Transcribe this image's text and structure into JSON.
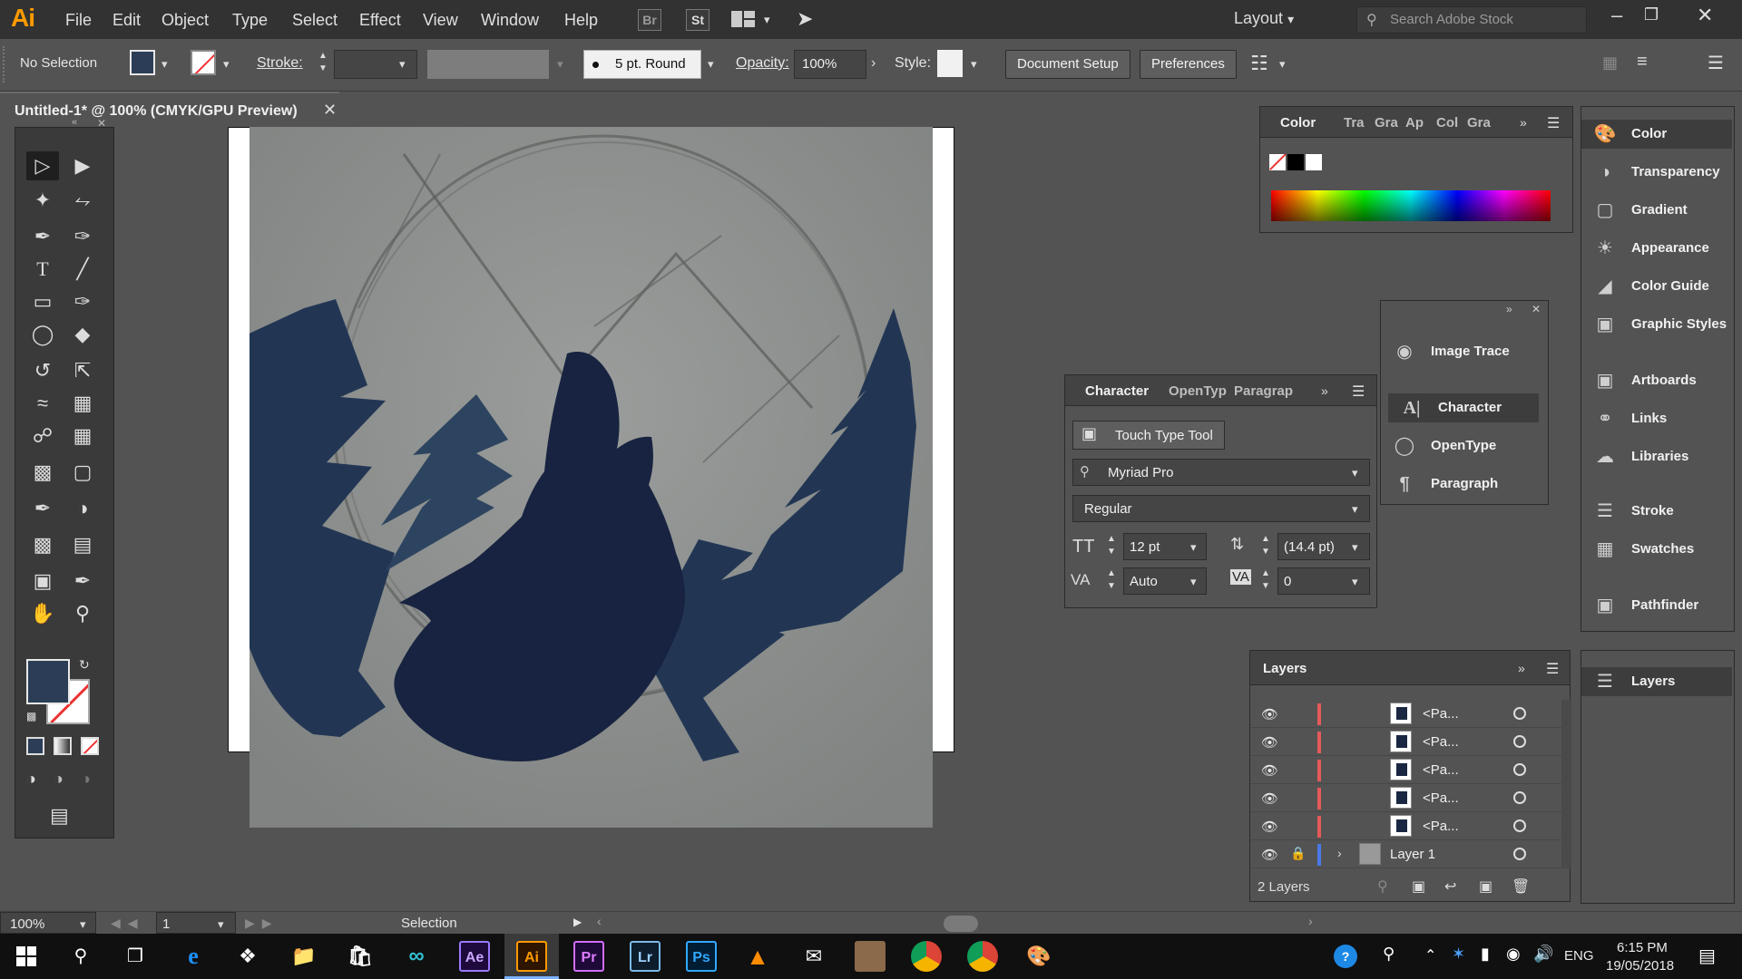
{
  "menubar": {
    "logo": "Ai",
    "menus": [
      "File",
      "Edit",
      "Object",
      "Type",
      "Select",
      "Effect",
      "View",
      "Window",
      "Help"
    ],
    "bridge": "Br",
    "stock": "St",
    "workspace": "Layout",
    "search_placeholder": "Search Adobe Stock"
  },
  "control": {
    "selection": "No Selection",
    "stroke_label": "Stroke:",
    "brush": "5 pt. Round",
    "opacity_label": "Opacity:",
    "opacity_value": "100%",
    "style_label": "Style:",
    "doc_setup": "Document Setup",
    "preferences": "Preferences"
  },
  "document": {
    "tab_title": "Untitled-1* @ 100% (CMYK/GPU Preview)"
  },
  "color_panel": {
    "tabs": [
      "Color",
      "Tra",
      "Gra",
      "Ap",
      "Col",
      "Gra"
    ]
  },
  "imagetrace_panel": {
    "items": [
      "Image Trace",
      "Character",
      "OpenType",
      "Paragraph"
    ]
  },
  "character_panel": {
    "tabs": [
      "Character",
      "OpenTyp",
      "Paragrap"
    ],
    "touch_type": "Touch Type Tool",
    "font_family": "Myriad Pro",
    "font_style": "Regular",
    "font_size": "12 pt",
    "leading": "(14.4 pt)",
    "kerning": "Auto",
    "tracking": "0"
  },
  "layers_panel": {
    "title": "Layers",
    "paths": [
      "<Pa...",
      "<Pa...",
      "<Pa...",
      "<Pa...",
      "<Pa..."
    ],
    "layer_name": "Layer 1",
    "count": "2 Layers"
  },
  "dock": {
    "items": [
      "Color",
      "Transparency",
      "Gradient",
      "Appearance",
      "Color Guide",
      "Graphic Styles",
      "Artboards",
      "Links",
      "Libraries",
      "Stroke",
      "Swatches",
      "Pathfinder"
    ],
    "layers": "Layers"
  },
  "status": {
    "zoom": "100%",
    "artboard": "1",
    "tool": "Selection"
  },
  "taskbar": {
    "apps": [
      "Ae",
      "Ai",
      "Pr",
      "Lr",
      "Ps"
    ],
    "lang": "ENG",
    "time": "6:15 PM",
    "date": "19/05/2018"
  },
  "colors": {
    "fill": "#2c3e57",
    "navy_dark": "#172340",
    "navy_mid": "#223654",
    "navy_light": "#2d4460",
    "ai_orange": "#ff9a00"
  }
}
